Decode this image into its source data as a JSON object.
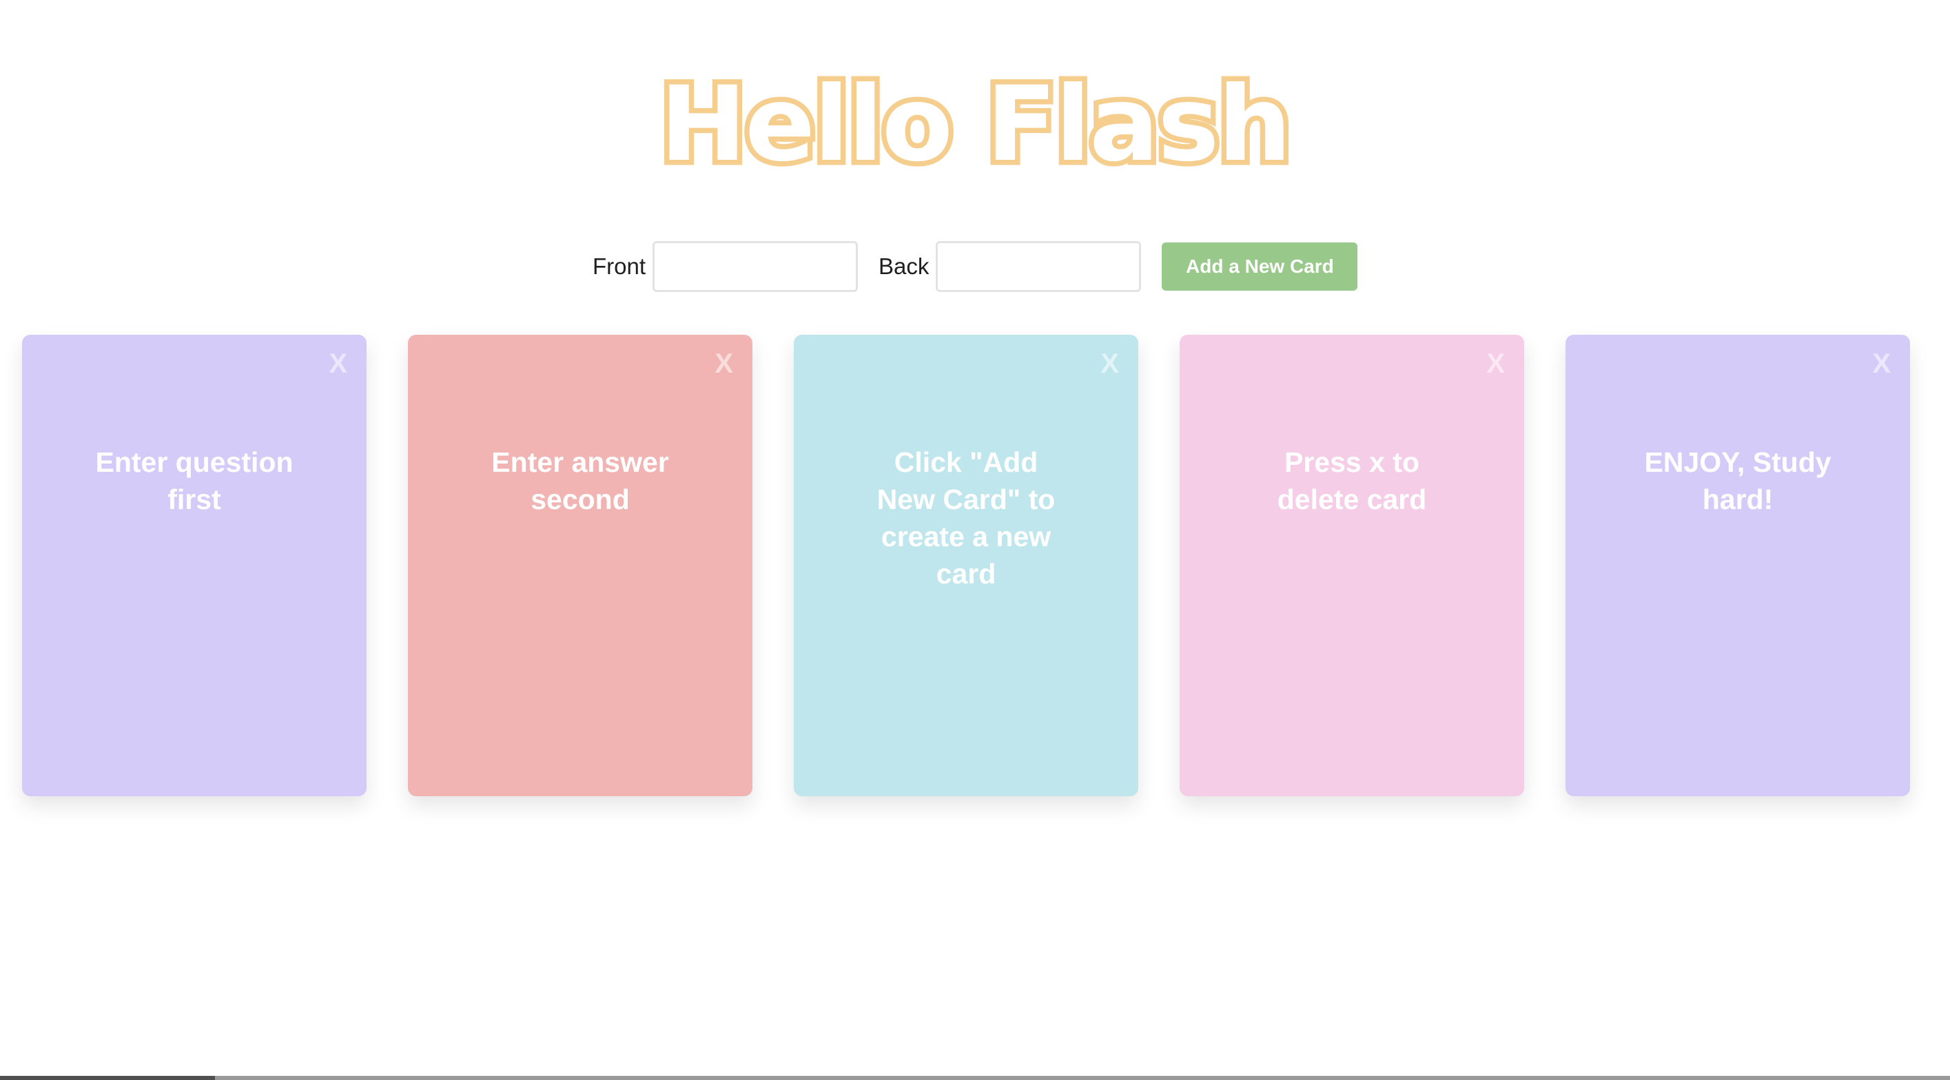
{
  "app": {
    "title": "Hello Flash"
  },
  "form": {
    "front_label": "Front",
    "front_value": "",
    "back_label": "Back",
    "back_value": "",
    "add_button_label": "Add a New Card"
  },
  "cards": [
    {
      "text": "Enter question first",
      "close_label": "X",
      "color": "#d5cbf8"
    },
    {
      "text": "Enter answer second",
      "close_label": "X",
      "color": "#f2b4b3"
    },
    {
      "text": "Click \"Add New Card\" to create a new card",
      "close_label": "X",
      "color": "#bfe6ec"
    },
    {
      "text": "Press x to delete card",
      "close_label": "X",
      "color": "#f5cde6"
    },
    {
      "text": "ENJOY, Study hard!",
      "close_label": "X",
      "color": "#d5cbf8"
    }
  ],
  "colors": {
    "logo": "#f5cd8c",
    "button": "#98c98a"
  },
  "icons": {
    "close": "close-icon"
  }
}
